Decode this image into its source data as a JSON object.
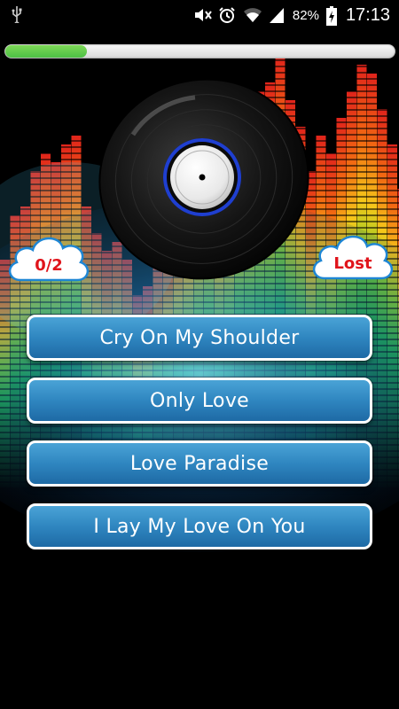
{
  "status_bar": {
    "battery_percent": "82%",
    "time": "17:13",
    "icons": [
      "usb-icon",
      "mute-icon",
      "alarm-icon",
      "wifi-icon",
      "signal-icon",
      "battery-charging-icon"
    ]
  },
  "progress": {
    "fraction": 0.21,
    "color": "#4cbf45"
  },
  "record": {
    "icon": "vinyl-record-icon",
    "ring_color": "#1f3fd0"
  },
  "score": {
    "label": "0/2"
  },
  "result": {
    "label": "Lost"
  },
  "answers": [
    {
      "label": "Cry On My Shoulder"
    },
    {
      "label": "Only Love"
    },
    {
      "label": "Love Paradise"
    },
    {
      "label": "I Lay My Love On You"
    }
  ],
  "colors": {
    "button": "#2f86c0",
    "badge_text": "#e0141b",
    "cloud": "#ffffff"
  }
}
